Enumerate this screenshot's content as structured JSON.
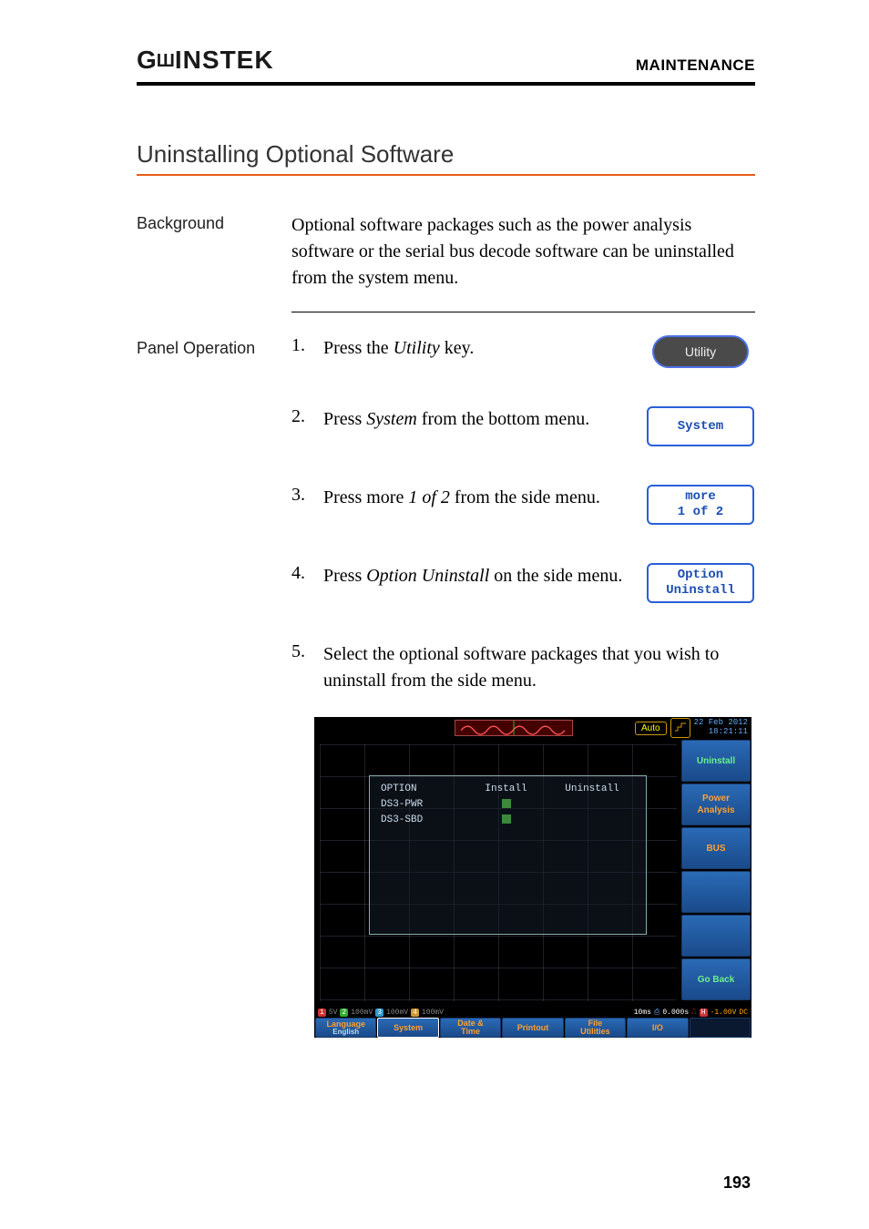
{
  "header": {
    "brand": "GWINSTEK",
    "title": "MAINTENANCE"
  },
  "section_title": "Uninstalling Optional Software",
  "background": {
    "label": "Background",
    "text": "Optional software packages such as the power analysis software or the serial bus decode software can be uninstalled from the system menu."
  },
  "operation": {
    "label": "Panel Operation",
    "steps": [
      {
        "num": "1.",
        "pre": "Press the ",
        "em": "Utility",
        "post": " key.",
        "btn_type": "oval",
        "btn_lines": [
          "Utility"
        ]
      },
      {
        "num": "2.",
        "pre": "Press ",
        "em": "System",
        "post": " from the bottom menu.",
        "btn_type": "rect",
        "btn_lines": [
          "System"
        ]
      },
      {
        "num": "3.",
        "pre": "Press more ",
        "em": "1 of 2",
        "post": " from the side menu.",
        "btn_type": "rect",
        "btn_lines": [
          "more",
          "1 of 2"
        ]
      },
      {
        "num": "4.",
        "pre": "Press ",
        "em": "Option Uninstall",
        "post": " on the side menu.",
        "btn_type": "rect",
        "btn_lines": [
          "Option",
          "Uninstall"
        ]
      },
      {
        "num": "5.",
        "pre": "Select the optional software packages that you wish to uninstall from the side menu.",
        "em": "",
        "post": "",
        "btn_type": "none",
        "btn_lines": []
      }
    ]
  },
  "screenshot": {
    "top": {
      "auto": "Auto",
      "date": "22 Feb 2012",
      "time": "18:21:11"
    },
    "dialog": {
      "headers": [
        "OPTION",
        "Install",
        "Uninstall"
      ],
      "rows": [
        {
          "name": "DS3-PWR",
          "install_check": true
        },
        {
          "name": "DS3-SBD",
          "install_check": true
        }
      ]
    },
    "side": {
      "title": "Uninstall",
      "items": [
        "Power\nAnalysis",
        "BUS",
        "",
        "",
        "Go Back"
      ]
    },
    "status": {
      "ch": [
        "1",
        "5V",
        "2",
        "100mV",
        "3",
        "100mV",
        "4",
        "100mV"
      ],
      "time": "10ms",
      "pos": "0.000s",
      "trig1": "H",
      "trig2": "-1.00V",
      "trig3": ".00V",
      "mode": "DC"
    },
    "bottom_tabs": [
      {
        "main": "Language",
        "sub": "English"
      },
      {
        "main": "System",
        "sub": ""
      },
      {
        "main": "Date &",
        "sub": "Time"
      },
      {
        "main": "Printout",
        "sub": ""
      },
      {
        "main": "File",
        "sub": "Utilities"
      },
      {
        "main": "I/O",
        "sub": ""
      },
      {
        "main": "",
        "sub": ""
      }
    ]
  },
  "page_number": "193"
}
